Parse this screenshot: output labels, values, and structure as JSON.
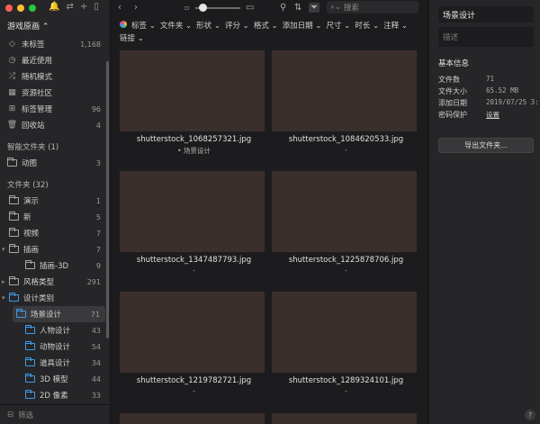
{
  "window": {
    "traffic_colors": [
      "#ff5f57",
      "#febc2e",
      "#28c840"
    ]
  },
  "sidebar": {
    "library_title": "游戏原画 ⌃",
    "items": [
      {
        "label": "未标签",
        "count": "1,168",
        "icon": "tag-icon"
      },
      {
        "label": "最近使用",
        "count": "",
        "icon": "clock-icon"
      },
      {
        "label": "随机模式",
        "count": "",
        "icon": "shuffle-icon"
      },
      {
        "label": "资源社区",
        "count": "",
        "icon": "community-icon"
      },
      {
        "label": "标签管理",
        "count": "96",
        "icon": "tag-manage-icon"
      },
      {
        "label": "回收站",
        "count": "4",
        "icon": "trash-icon"
      }
    ],
    "smart_section": "智能文件夹 (1)",
    "smart_items": [
      {
        "label": "动图",
        "count": "3"
      }
    ],
    "folder_section": "文件夹 (32)",
    "folders": [
      {
        "label": "演示",
        "count": "1",
        "indent": 0,
        "color": "gray",
        "caret": ""
      },
      {
        "label": "新",
        "count": "5",
        "indent": 0,
        "color": "gray",
        "caret": ""
      },
      {
        "label": "视频",
        "count": "7",
        "indent": 0,
        "color": "gray",
        "caret": ""
      },
      {
        "label": "插画",
        "count": "7",
        "indent": 0,
        "color": "gray",
        "caret": "▾"
      },
      {
        "label": "插画-3D",
        "count": "9",
        "indent": 1,
        "color": "gray",
        "caret": ""
      },
      {
        "label": "风格类型",
        "count": "291",
        "indent": 0,
        "color": "gray",
        "caret": "▸"
      },
      {
        "label": "设计类别",
        "count": "",
        "indent": 0,
        "color": "blue",
        "caret": "▾"
      },
      {
        "label": "场景设计",
        "count": "71",
        "indent": 1,
        "color": "blue",
        "caret": "",
        "selected": true
      },
      {
        "label": "人物设计",
        "count": "43",
        "indent": 1,
        "color": "blue",
        "caret": ""
      },
      {
        "label": "动物设计",
        "count": "54",
        "indent": 1,
        "color": "blue",
        "caret": ""
      },
      {
        "label": "道具设计",
        "count": "34",
        "indent": 1,
        "color": "blue",
        "caret": ""
      },
      {
        "label": "3D 模型",
        "count": "44",
        "indent": 1,
        "color": "blue",
        "caret": ""
      },
      {
        "label": "2D 像素",
        "count": "33",
        "indent": 1,
        "color": "blue",
        "caret": ""
      }
    ],
    "filter_placeholder": "筛选"
  },
  "toolbar": {
    "search_placeholder": "搜索"
  },
  "filters": [
    "标签 ⌄",
    "文件夹 ⌄",
    "形状 ⌄",
    "评分 ⌄",
    "格式 ⌄",
    "添加日期 ⌄",
    "尺寸 ⌄",
    "时长 ⌄",
    "注释 ⌄",
    "链接 ⌄"
  ],
  "grid": {
    "items": [
      {
        "name": "shutterstock_1068257321.jpg",
        "tag": "• 场景设计"
      },
      {
        "name": "shutterstock_1084620533.jpg",
        "tag": "-"
      },
      {
        "name": "shutterstock_1347487793.jpg",
        "tag": "-"
      },
      {
        "name": "shutterstock_1225878706.jpg",
        "tag": "-"
      },
      {
        "name": "shutterstock_1219782721.jpg",
        "tag": "-"
      },
      {
        "name": "shutterstock_1289324101.jpg",
        "tag": "-"
      }
    ]
  },
  "inspector": {
    "name": "场景设计",
    "desc_placeholder": "描述",
    "info_title": "基本信息",
    "rows": [
      {
        "k": "文件数",
        "v": "71"
      },
      {
        "k": "文件大小",
        "v": "65.52 MB"
      },
      {
        "k": "添加日期",
        "v": "2019/07/25 3:"
      },
      {
        "k": "密码保护",
        "v": "设置"
      }
    ],
    "export_label": "导出文件夹...",
    "help_label": "?"
  }
}
